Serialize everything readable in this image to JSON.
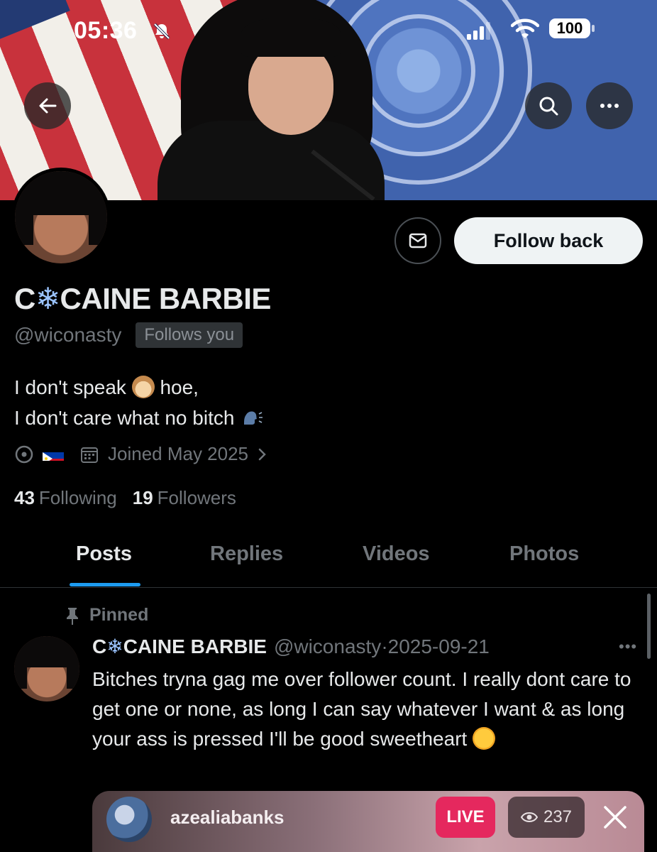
{
  "status_bar": {
    "time": "05:36",
    "battery": "100"
  },
  "profile": {
    "name_prefix": "C",
    "name_snowflake": "❄",
    "name_suffix": "CAINE BARBIE",
    "handle": "@wiconasty",
    "follows_you": "Follows you",
    "bio_line1_a": "I don't speak",
    "bio_line1_b": "hoe,",
    "bio_line2": "I don't care what no bitch",
    "joined": "Joined May 2025",
    "following_count": "43",
    "following_label": "Following",
    "followers_count": "19",
    "followers_label": "Followers"
  },
  "actions": {
    "follow_back": "Follow back"
  },
  "tabs": [
    "Posts",
    "Replies",
    "Videos",
    "Photos"
  ],
  "post": {
    "pinned_label": "Pinned",
    "author_prefix": "C",
    "author_snowflake": "❄",
    "author_suffix": "CAINE BARBIE",
    "handle": "@wiconasty",
    "separator": "·",
    "date": "2025-09-21",
    "text": "Bitches tryna gag me over follower count. I really dont care to get one or none, as long I can say whatever I want & as long your ass is pressed I'll be good sweetheart"
  },
  "live": {
    "username": "azealiabanks",
    "tag": "LIVE",
    "viewers": "237"
  },
  "colors": {
    "accent": "#1d9bf0",
    "live": "#e5285e",
    "muted": "#71767b"
  }
}
